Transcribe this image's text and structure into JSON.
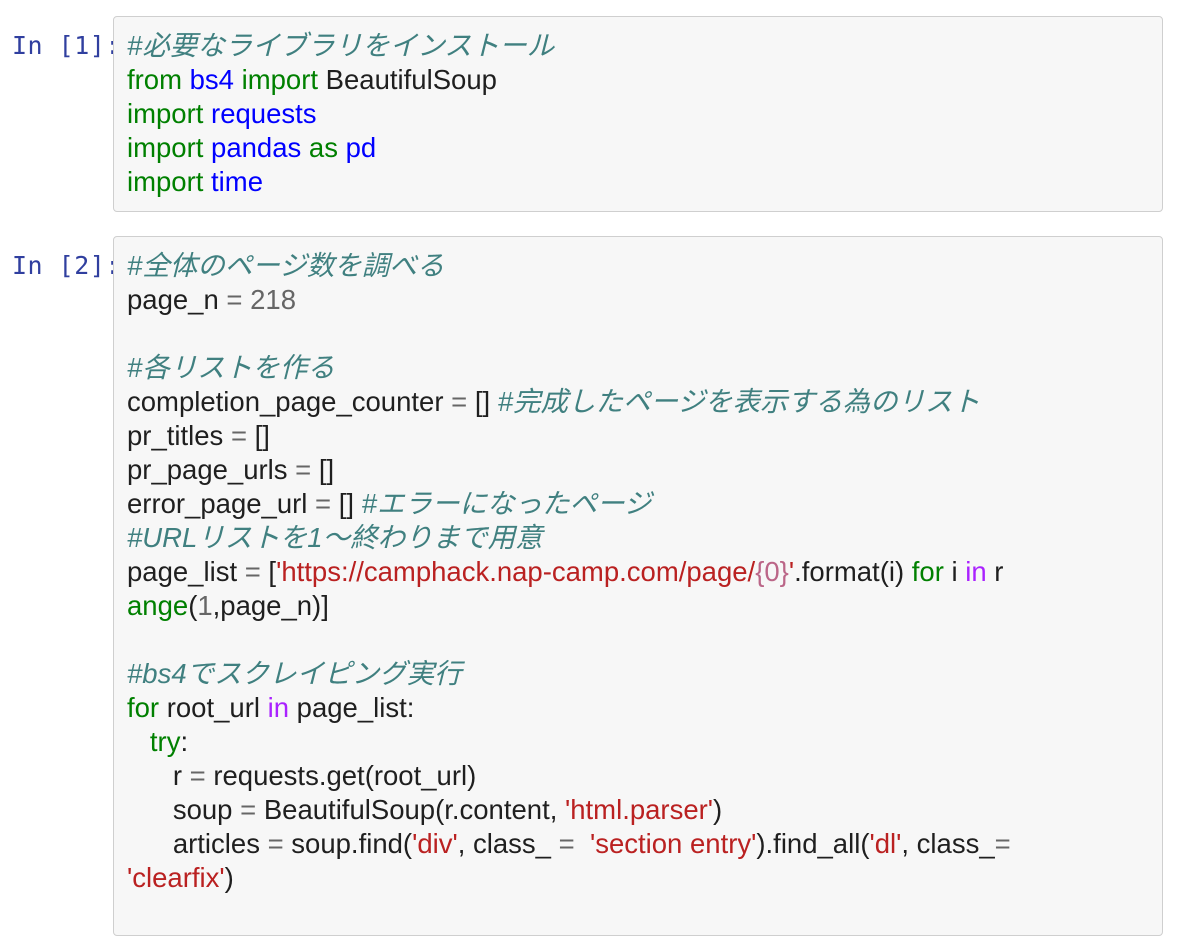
{
  "cells": [
    {
      "prompt": "In [1]:",
      "lines": [
        [
          {
            "t": "#必要なライブラリをインストール",
            "c": "cm"
          }
        ],
        [
          {
            "t": "from",
            "c": "kw"
          },
          {
            "t": " "
          },
          {
            "t": "bs4",
            "c": "nn"
          },
          {
            "t": " "
          },
          {
            "t": "import",
            "c": "kw"
          },
          {
            "t": " BeautifulSoup"
          }
        ],
        [
          {
            "t": "import",
            "c": "kw"
          },
          {
            "t": " "
          },
          {
            "t": "requests",
            "c": "nn"
          }
        ],
        [
          {
            "t": "import",
            "c": "kw"
          },
          {
            "t": " "
          },
          {
            "t": "pandas",
            "c": "nn"
          },
          {
            "t": " "
          },
          {
            "t": "as",
            "c": "kw"
          },
          {
            "t": " "
          },
          {
            "t": "pd",
            "c": "nn"
          }
        ],
        [
          {
            "t": "import",
            "c": "kw"
          },
          {
            "t": " "
          },
          {
            "t": "time",
            "c": "nn"
          }
        ]
      ]
    },
    {
      "prompt": "In [2]:",
      "lines": [
        [
          {
            "t": "#全体のページ数を調べる",
            "c": "cm"
          }
        ],
        [
          {
            "t": "page_n "
          },
          {
            "t": "=",
            "c": "op"
          },
          {
            "t": " "
          },
          {
            "t": "218",
            "c": "mi"
          }
        ],
        [],
        [
          {
            "t": "#各リストを作る",
            "c": "cm"
          }
        ],
        [
          {
            "t": "completion_page_counter "
          },
          {
            "t": "=",
            "c": "op"
          },
          {
            "t": " [] "
          },
          {
            "t": "#完成したページを表示する為のリスト",
            "c": "cm"
          }
        ],
        [
          {
            "t": "pr_titles "
          },
          {
            "t": "=",
            "c": "op"
          },
          {
            "t": " []"
          }
        ],
        [
          {
            "t": "pr_page_urls "
          },
          {
            "t": "=",
            "c": "op"
          },
          {
            "t": " []"
          }
        ],
        [
          {
            "t": "error_page_url "
          },
          {
            "t": "=",
            "c": "op"
          },
          {
            "t": " [] "
          },
          {
            "t": "#エラーになったページ",
            "c": "cm"
          }
        ],
        [
          {
            "t": "#URLリストを1〜終わりまで用意",
            "c": "cm"
          }
        ],
        [
          {
            "t": "page_list "
          },
          {
            "t": "=",
            "c": "op"
          },
          {
            "t": " ["
          },
          {
            "t": "'https://camphack.nap-camp.com/page/",
            "c": "st"
          },
          {
            "t": "{0}",
            "c": "si"
          },
          {
            "t": "'",
            "c": "st"
          },
          {
            "t": ".format(i) "
          },
          {
            "t": "for",
            "c": "kw"
          },
          {
            "t": " i "
          },
          {
            "t": "in",
            "c": "ow"
          },
          {
            "t": " r"
          }
        ],
        [
          {
            "t": "ange",
            "c": "nb"
          },
          {
            "t": "("
          },
          {
            "t": "1",
            "c": "mi"
          },
          {
            "t": ",page_n)]"
          }
        ],
        [],
        [
          {
            "t": "#bs4でスクレイピング実行",
            "c": "cm"
          }
        ],
        [
          {
            "t": "for",
            "c": "kw"
          },
          {
            "t": " root_url "
          },
          {
            "t": "in",
            "c": "ow"
          },
          {
            "t": " page_list:"
          }
        ],
        [
          {
            "t": "   "
          },
          {
            "t": "try",
            "c": "kw"
          },
          {
            "t": ":"
          }
        ],
        [
          {
            "t": "      r "
          },
          {
            "t": "=",
            "c": "op"
          },
          {
            "t": " requests.get(root_url)"
          }
        ],
        [
          {
            "t": "      soup "
          },
          {
            "t": "=",
            "c": "op"
          },
          {
            "t": " BeautifulSoup(r.content, "
          },
          {
            "t": "'html.parser'",
            "c": "st"
          },
          {
            "t": ")"
          }
        ],
        [
          {
            "t": "      articles "
          },
          {
            "t": "=",
            "c": "op"
          },
          {
            "t": " soup.find("
          },
          {
            "t": "'div'",
            "c": "st"
          },
          {
            "t": ", class_ "
          },
          {
            "t": "=",
            "c": "op"
          },
          {
            "t": "  "
          },
          {
            "t": "'section entry'",
            "c": "st"
          },
          {
            "t": ").find_all("
          },
          {
            "t": "'dl'",
            "c": "st"
          },
          {
            "t": ", class_"
          },
          {
            "t": "=",
            "c": "op"
          }
        ],
        [
          {
            "t": "'clearfix'",
            "c": "st"
          },
          {
            "t": ")"
          }
        ]
      ]
    }
  ]
}
